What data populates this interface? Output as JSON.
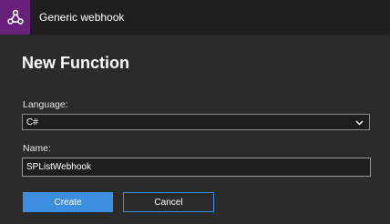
{
  "window": {
    "title": "Generic webhook",
    "icon": "webhook-icon",
    "accent_color": "#68217a"
  },
  "dialog": {
    "heading": "New Function",
    "language": {
      "label": "Language:",
      "selected": "C#"
    },
    "name": {
      "label": "Name:",
      "value": "SPListWebhook"
    },
    "buttons": {
      "create": "Create",
      "cancel": "Cancel"
    },
    "button_color": "#3d8ee0"
  }
}
